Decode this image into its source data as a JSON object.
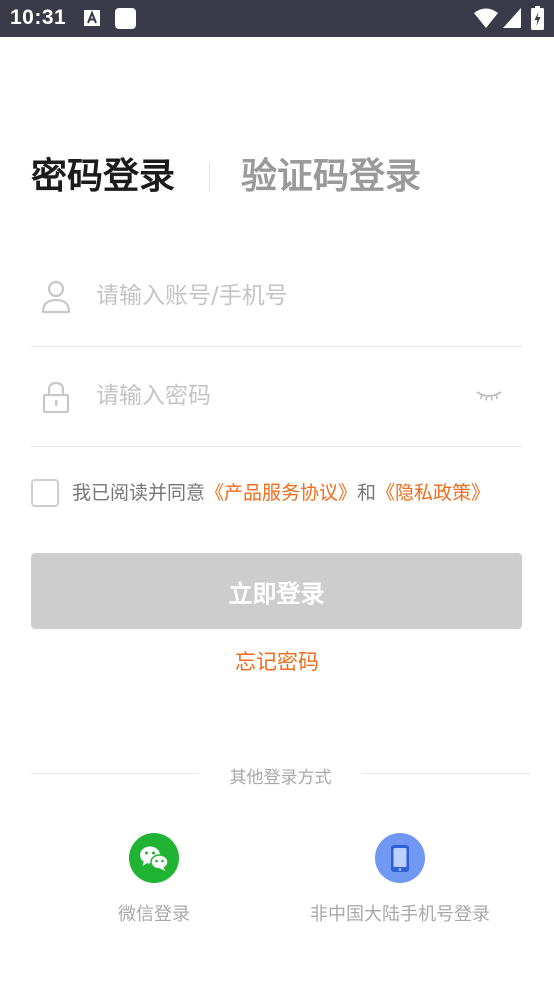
{
  "statusbar": {
    "time": "10:31",
    "icons": [
      "a-notification-icon",
      "square-notification-icon",
      "wifi-icon",
      "signal-icon",
      "battery-icon"
    ]
  },
  "tabs": {
    "password_login": "密码登录",
    "code_login": "验证码登录",
    "active": "password_login"
  },
  "form": {
    "account_placeholder": "请输入账号/手机号",
    "account_value": "",
    "password_placeholder": "请输入密码",
    "password_value": ""
  },
  "agreement": {
    "checked": false,
    "prefix": "我已阅读并同意",
    "terms_link": "《产品服务协议》",
    "and": "和",
    "privacy_link": "《隐私政策》"
  },
  "actions": {
    "login_button": "立即登录",
    "forgot_password": "忘记密码"
  },
  "other_login": {
    "title": "其他登录方式",
    "wechat_label": "微信登录",
    "overseas_label": "非中国大陆手机号登录"
  },
  "colors": {
    "accent": "#f26c1c",
    "button_disabled": "#cdcdcd",
    "wechat_green": "#21b334",
    "phone_blue": "#7098f2",
    "statusbar": "#3a3a48"
  }
}
